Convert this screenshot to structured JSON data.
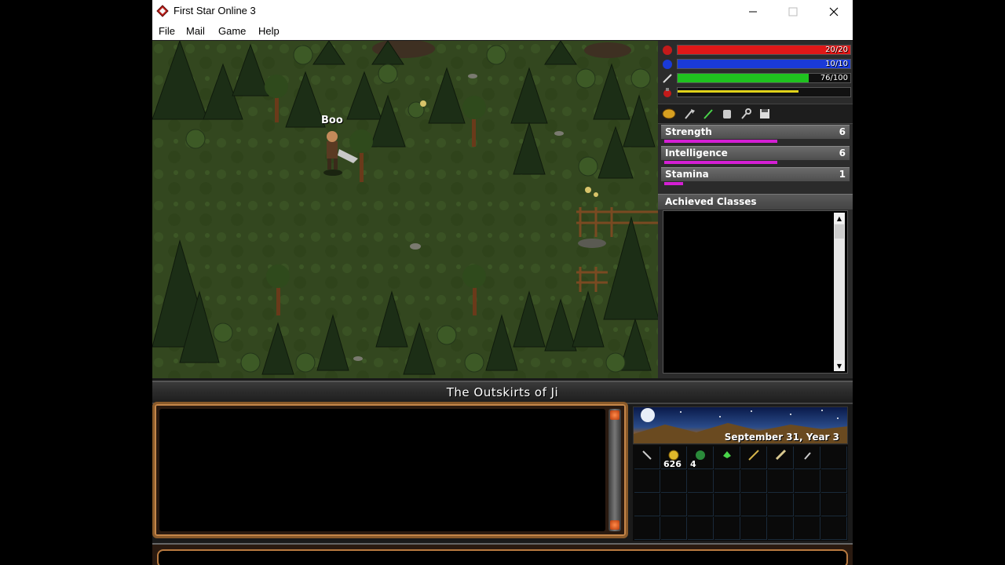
{
  "window": {
    "title": "First Star Online 3",
    "menu": [
      "File",
      "Mail",
      "Game",
      "Help"
    ]
  },
  "game": {
    "player_name": "Boo",
    "location": "The Outskirts of Ji"
  },
  "vitals": [
    {
      "name": "health",
      "text": "20/20",
      "fraction": 1.0,
      "color": "#e01818"
    },
    {
      "name": "mana",
      "text": "10/10",
      "fraction": 1.0,
      "color": "#1a3ad8"
    },
    {
      "name": "stamina",
      "text": "76/100",
      "fraction": 0.76,
      "color": "#1fc21f"
    },
    {
      "name": "experience",
      "text": "",
      "fraction": 0.7,
      "color": "#e0d21a"
    }
  ],
  "stats": [
    {
      "name": "Strength",
      "value": "6",
      "fraction": 0.6
    },
    {
      "name": "Intelligence",
      "value": "6",
      "fraction": 0.6
    },
    {
      "name": "Stamina",
      "value": "1",
      "fraction": 0.1
    }
  ],
  "classes": {
    "title": "Achieved Classes"
  },
  "calendar": {
    "date": "September 31, Year 3"
  },
  "inventory": [
    {
      "item": "arrow-icon",
      "qty": ""
    },
    {
      "item": "gold-coins-icon",
      "qty": "626"
    },
    {
      "item": "herb-icon",
      "qty": "4"
    },
    {
      "item": "leaf-icon",
      "qty": ""
    },
    {
      "item": "wand-icon",
      "qty": ""
    },
    {
      "item": "sword-icon",
      "qty": ""
    },
    {
      "item": "dagger-icon",
      "qty": ""
    }
  ]
}
